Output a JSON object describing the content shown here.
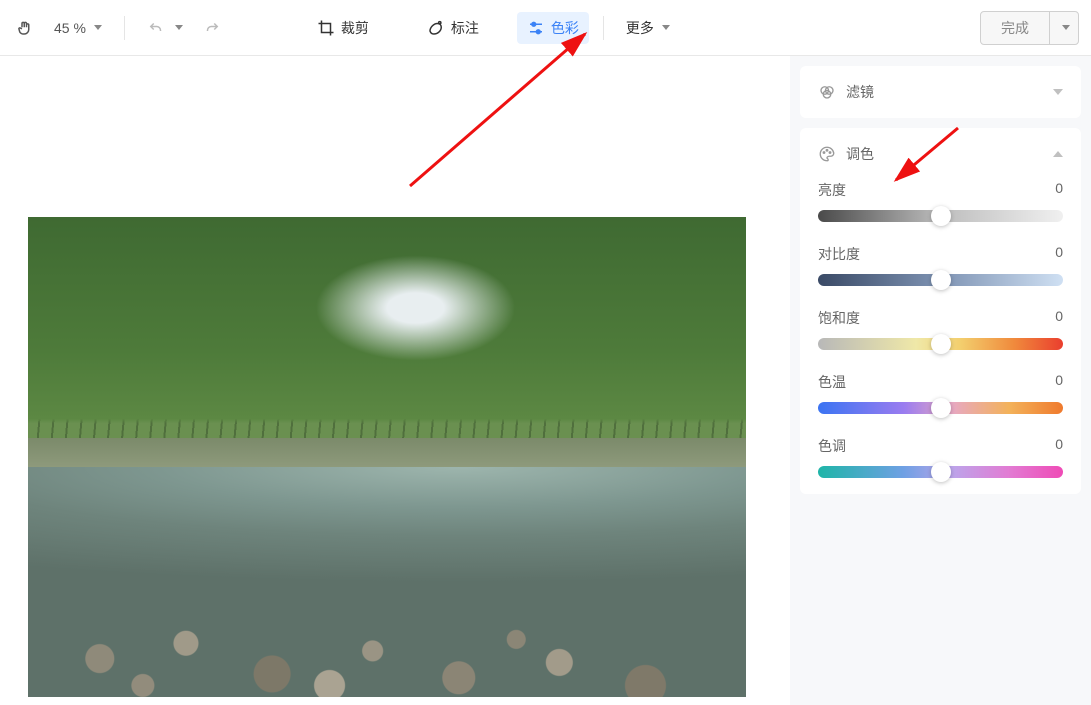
{
  "toolbar": {
    "zoom_label": "45 %",
    "crop_label": "裁剪",
    "annotate_label": "标注",
    "color_label": "色彩",
    "more_label": "更多",
    "done_label": "完成"
  },
  "sidebar": {
    "filters": {
      "title": "滤镜"
    },
    "adjust": {
      "title": "调色",
      "sliders": [
        {
          "label": "亮度",
          "value": "0",
          "gradient": "g-bright"
        },
        {
          "label": "对比度",
          "value": "0",
          "gradient": "g-contrast"
        },
        {
          "label": "饱和度",
          "value": "0",
          "gradient": "g-sat"
        },
        {
          "label": "色温",
          "value": "0",
          "gradient": "g-temp"
        },
        {
          "label": "色调",
          "value": "0",
          "gradient": "g-tint"
        }
      ]
    }
  }
}
